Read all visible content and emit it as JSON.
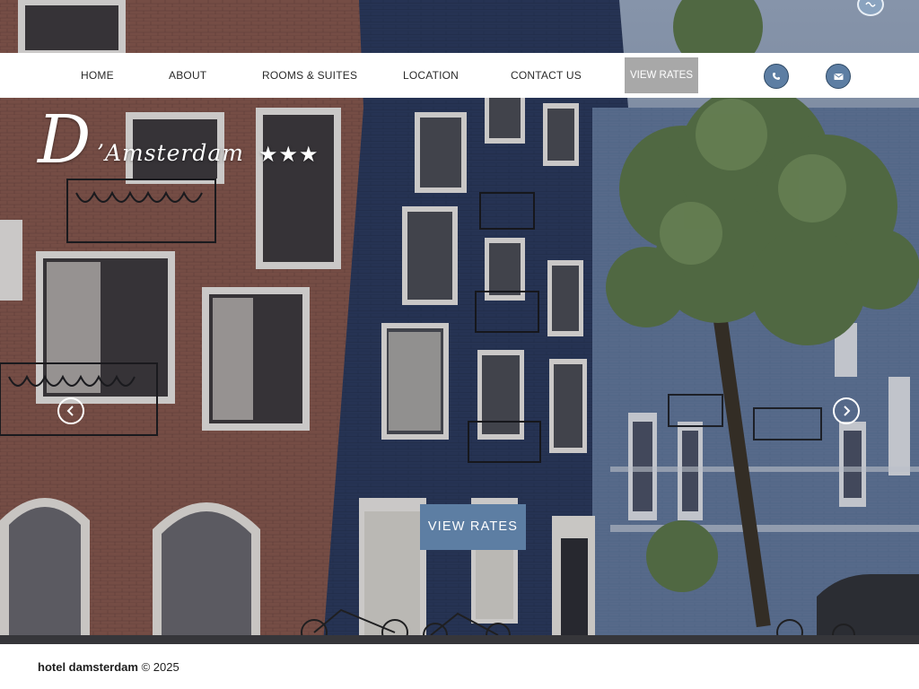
{
  "nav": {
    "items": [
      {
        "label": "HOME"
      },
      {
        "label": "ABOUT"
      },
      {
        "label": "ROOMS & SUITES"
      },
      {
        "label": "LOCATION"
      },
      {
        "label": "CONTACT US"
      }
    ],
    "cta_label": "VIEW RATES",
    "cta_color": "#a8a8a8",
    "icons": [
      "phone-icon",
      "envelope-icon"
    ]
  },
  "top_icon": "language-icon",
  "logo": {
    "letter": "D",
    "wordmark": "’Amsterdam",
    "stars": "★★★"
  },
  "hero": {
    "cta_label": "VIEW RATES",
    "cta_color": "#5d7ea3",
    "prev_icon": "chevron-left-icon",
    "next_icon": "chevron-right-icon"
  },
  "footer": {
    "brand": "hotel damsterdam",
    "copyright": " © 2025"
  },
  "colors": {
    "accent": "#5d7ea3",
    "nav_background": "#ffffff",
    "text": "#2a2a2a"
  }
}
